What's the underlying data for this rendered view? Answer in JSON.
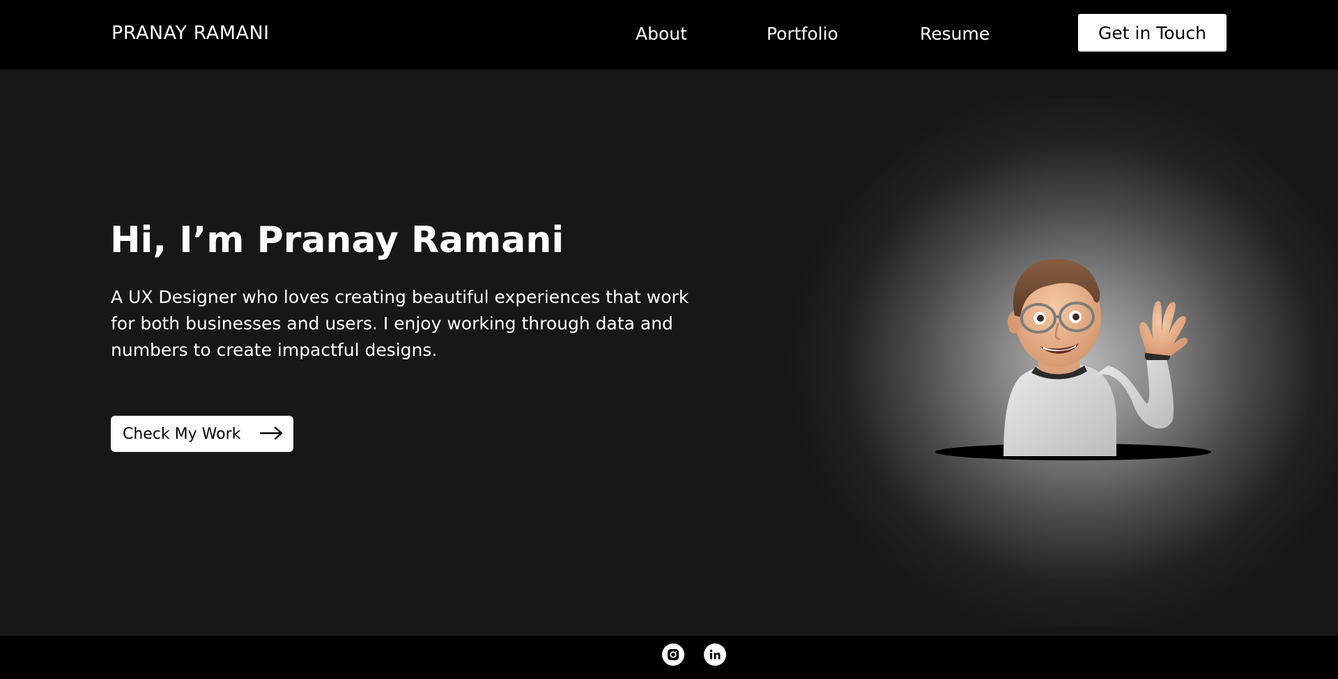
{
  "header": {
    "brand": "PRANAY RAMANI",
    "nav": [
      {
        "label": "About"
      },
      {
        "label": "Portfolio"
      },
      {
        "label": "Resume"
      }
    ],
    "cta_label": "Get in Touch"
  },
  "hero": {
    "title": "Hi, I’m Pranay Ramani",
    "description": "A UX Designer who loves creating beautiful experiences that work for both businesses and users. I enjoy working through data and numbers to create impactful designs.",
    "button_label": "Check My Work",
    "button_icon": "arrow-right-icon",
    "illustration": "waving-memoji-avatar"
  },
  "footer": {
    "social": [
      {
        "icon": "instagram-icon"
      },
      {
        "icon": "linkedin-icon"
      }
    ]
  },
  "colors": {
    "header_bg": "#000000",
    "hero_bg": "#171717",
    "button_bg": "#ffffff",
    "text": "#ffffff"
  }
}
